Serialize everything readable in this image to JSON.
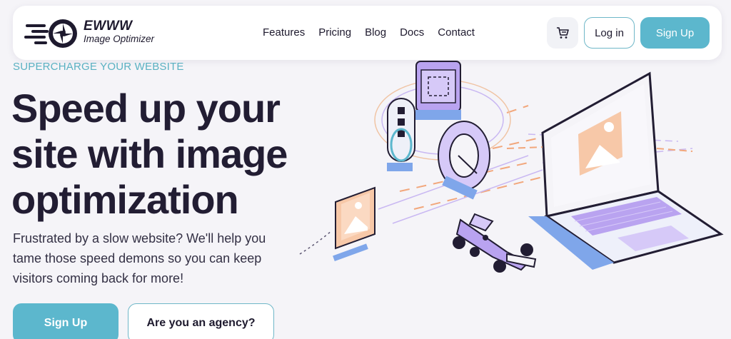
{
  "brand": {
    "name": "EWWW",
    "subtitle": "Image Optimizer"
  },
  "nav": {
    "links": [
      "Features",
      "Pricing",
      "Blog",
      "Docs",
      "Contact"
    ],
    "login_label": "Log in",
    "signup_label": "Sign Up",
    "cart_icon": "cart-icon"
  },
  "hero": {
    "eyebrow": "SUPERCHARGE YOUR WEBSITE",
    "headline": "Speed up your site with image optimization",
    "subtext": "Frustrated by a slow website? We'll help you tame those speed demons so you can keep visitors coming back for more!",
    "cta_primary": "Sign Up",
    "cta_secondary": "Are you an agency?"
  },
  "colors": {
    "accent": "#5cb7cd",
    "text": "#221d33",
    "background": "#f5f4f8",
    "illustration_purple": "#b9a3f0",
    "illustration_peach": "#f7c8a8"
  }
}
